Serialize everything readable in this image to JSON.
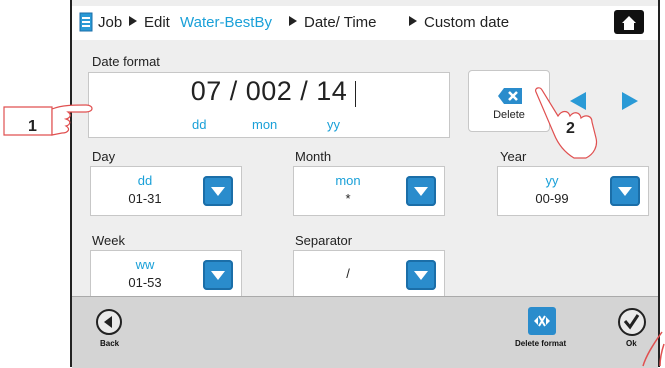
{
  "breadcrumb": [
    "Job",
    "Edit",
    "Water-BestBy",
    "Date/ Time",
    "Custom date"
  ],
  "date_format": {
    "label": "Date format",
    "value": "07 / 002 / 14",
    "parts": [
      "dd",
      "mon",
      "yy"
    ]
  },
  "delete_label": "Delete",
  "fields": {
    "day": {
      "label": "Day",
      "code": "dd",
      "range": "01-31"
    },
    "month": {
      "label": "Month",
      "code": "mon",
      "range": "*"
    },
    "year": {
      "label": "Year",
      "code": "yy",
      "range": "00-99"
    },
    "week": {
      "label": "Week",
      "code": "ww",
      "range": "01-53"
    },
    "separator": {
      "label": "Separator",
      "value": "/"
    }
  },
  "footer": {
    "back_label": "Back",
    "delete_format_label": "Delete format",
    "ok_label": "Ok"
  },
  "callouts": [
    "1",
    "2"
  ],
  "colors": {
    "accent": "#1aa0d8",
    "dropdown": "#2a8ccc",
    "hand_outline": "#e05050"
  }
}
